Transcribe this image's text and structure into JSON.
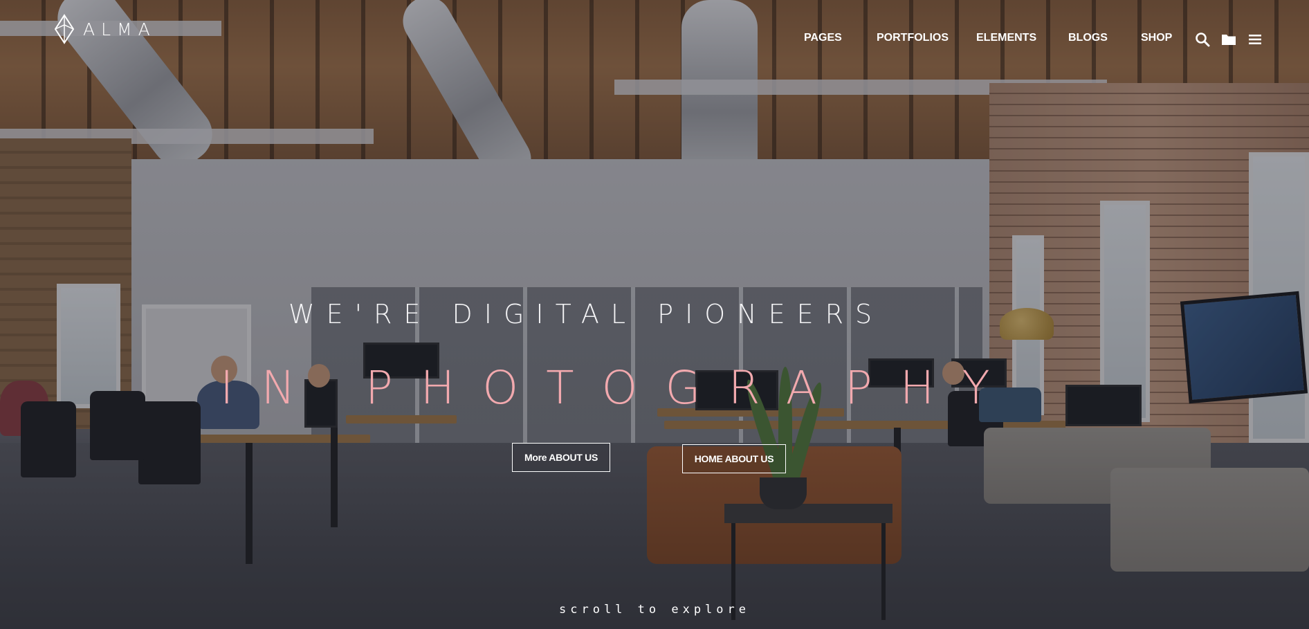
{
  "brand": {
    "name": "ALMA",
    "logo_icon": "diamond-logo-icon"
  },
  "nav": {
    "items": [
      {
        "label": "PAGES"
      },
      {
        "label": "PORTFOLIOS"
      },
      {
        "label": "ELEMENTS"
      },
      {
        "label": "BLOGS"
      },
      {
        "label": "SHOP"
      }
    ],
    "icons": [
      "search-icon",
      "folder-icon",
      "hamburger-menu-icon"
    ]
  },
  "hero": {
    "tagline": "WE'RE DIGITAL PIONEERS",
    "headline": "IN PHOTOGRAPHY",
    "buttons": {
      "more": "More ABOUT US",
      "home": "HOME ABOUT US"
    },
    "scroll_hint": "scroll to explore"
  },
  "colors": {
    "headline": "#f2a9ae",
    "text": "#ffffff"
  }
}
